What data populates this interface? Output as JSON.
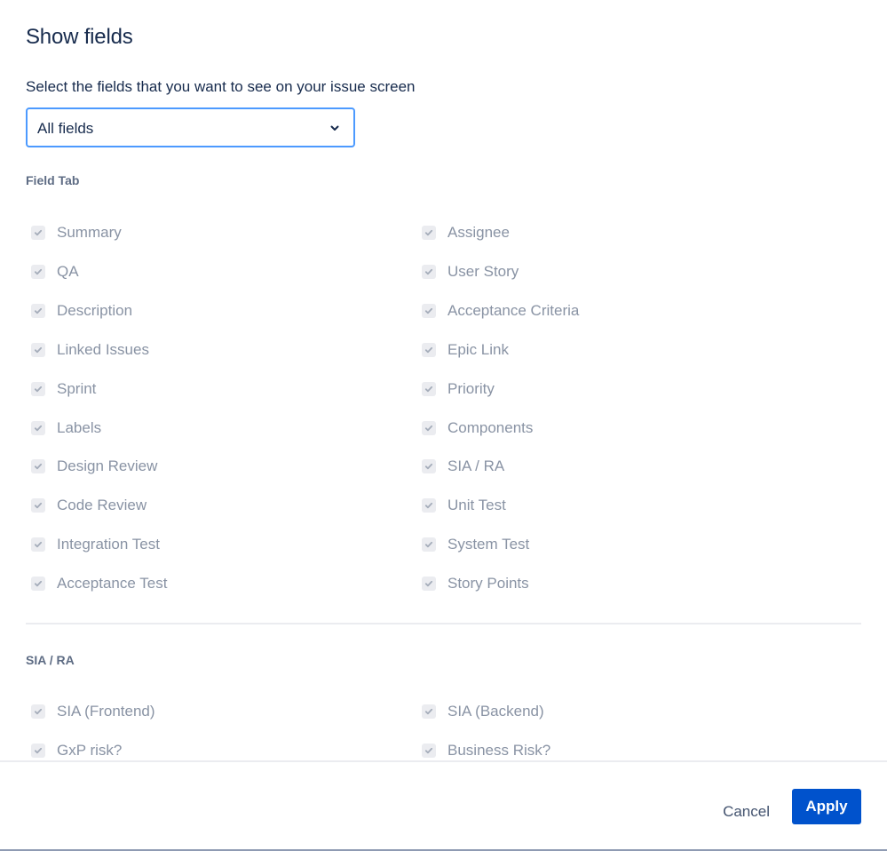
{
  "dialog": {
    "title": "Show fields",
    "select_label": "Select the fields that you want to see on your issue screen",
    "select_value": "All fields"
  },
  "sections": [
    {
      "title": "Field Tab",
      "left": [
        "Summary",
        "QA",
        "Description",
        "Linked Issues",
        "Sprint",
        "Labels",
        "Design Review",
        "Code Review",
        "Integration Test",
        "Acceptance Test"
      ],
      "right": [
        "Assignee",
        "User Story",
        "Acceptance Criteria",
        "Epic Link",
        "Priority",
        "Components",
        "SIA / RA",
        "Unit Test",
        "System Test",
        "Story Points"
      ]
    },
    {
      "title": "SIA / RA",
      "left": [
        "SIA (Frontend)",
        "GxP risk?"
      ],
      "right": [
        "SIA (Backend)",
        "Business Risk?"
      ]
    }
  ],
  "footer": {
    "cancel_label": "Cancel",
    "apply_label": "Apply"
  },
  "colors": {
    "primary": "#0052cc",
    "focus_border": "#4c9aff",
    "disabled_text": "#8993a4",
    "heading": "#172b4d"
  },
  "icons": {
    "select": "chevron-down-icon",
    "checkbox": "checkmark-icon"
  }
}
